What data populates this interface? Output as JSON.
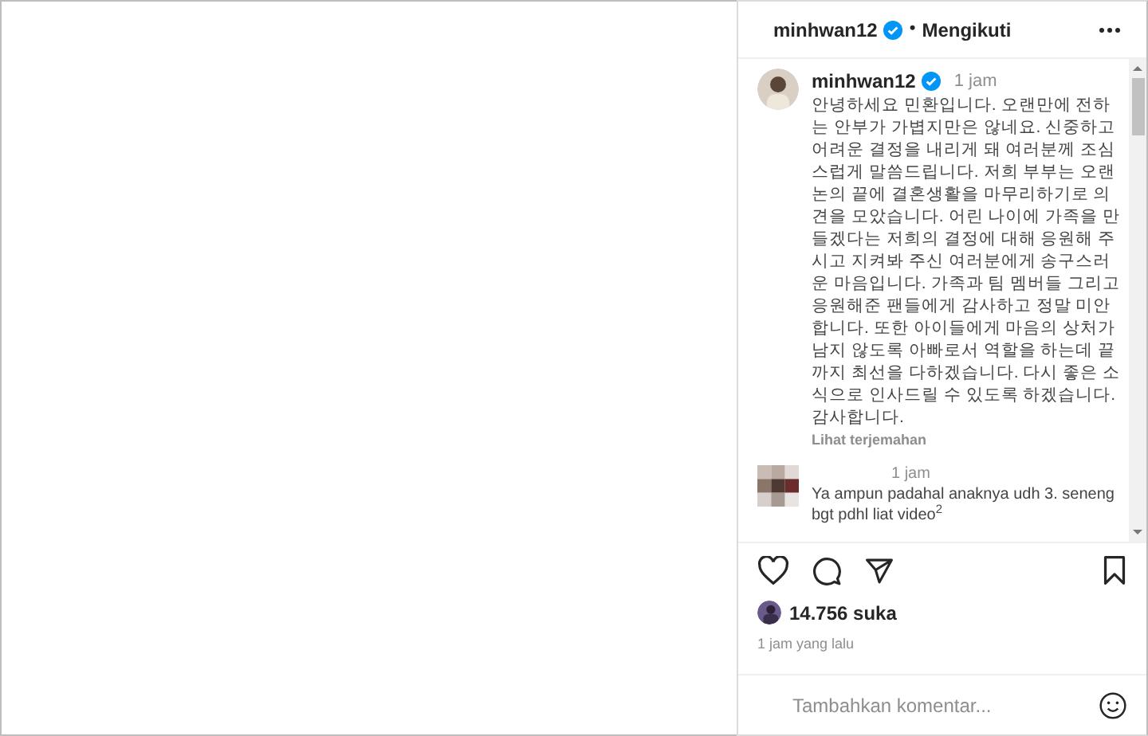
{
  "header": {
    "username": "minhwan12",
    "verified": true,
    "separator": "•",
    "follow_status": "Mengikuti"
  },
  "caption": {
    "username": "minhwan12",
    "verified": true,
    "time": "1 jam",
    "text": "안녕하세요 민환입니다. 오랜만에 전하는 안부가 가볍지만은 않네요. 신중하고 어려운 결정을 내리게 돼 여러분께 조심스럽게 말씀드립니다. 저희 부부는 오랜 논의 끝에 결혼생활을 마무리하기로 의견을 모았습니다. 어린 나이에 가족을 만들겠다는 저희의 결정에 대해 응원해 주시고 지켜봐 주신 여러분에게 송구스러운 마음입니다. 가족과 팀 멤버들 그리고 응원해준 팬들에게 감사하고 정말 미안합니다. 또한 아이들에게 마음의 상처가 남지 않도록 아빠로서 역할을 하는데 끝까지 최선을 다하겠습니다. 다시 좋은 소식으로 인사드릴 수 있도록 하겠습니다. 감사합니다.",
    "translate": "Lihat terjemahan"
  },
  "comments": [
    {
      "time": "1 jam",
      "text": "Ya ampun padahal anaknya udh 3. seneng bgt pdhl liat video$^{2}$"
    }
  ],
  "likes": "14.756 suka",
  "posted": "1 jam yang lalu",
  "comment_box": {
    "placeholder": "Tambahkan komentar..."
  }
}
